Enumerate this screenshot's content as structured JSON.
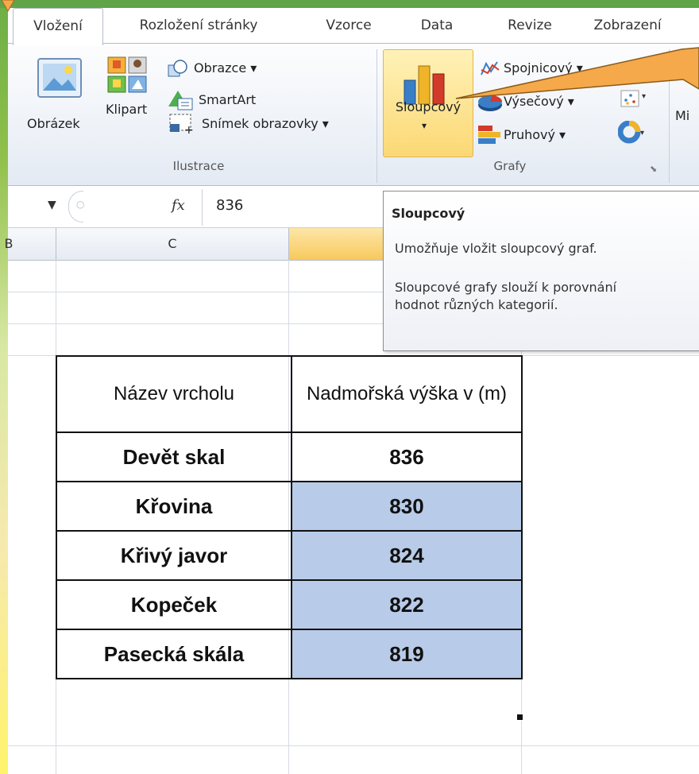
{
  "tabs": [
    {
      "label": "Vložení",
      "active": true
    },
    {
      "label": "Rozložení stránky"
    },
    {
      "label": "Vzorce"
    },
    {
      "label": "Data"
    },
    {
      "label": "Revize"
    },
    {
      "label": "Zobrazení"
    }
  ],
  "ribbon": {
    "ilustrace": {
      "obrazek": "Obrázek",
      "klipart": "Klipart",
      "obrazce": "Obrazce ▾",
      "smartart": "SmartArt",
      "snimek": "Snímek obrazovky ▾",
      "group_label": "Ilustrace"
    },
    "grafy": {
      "sloupcovy": "Sloupcový",
      "spojnicovy": "Spojnicový ▾",
      "vysecovy": "Výsečový ▾",
      "pruhovy": "Pruhový ▾",
      "group_label": "Grafy",
      "cut_text": "Mi"
    }
  },
  "formula_bar": {
    "fx": "fx",
    "value": "836"
  },
  "columns": {
    "b": "B",
    "c": "C"
  },
  "tooltip": {
    "title": "Sloupcový",
    "line1": "Umožňuje vložit sloupcový graf.",
    "line2": "Sloupcové grafy slouží k porovnání hodnot různých kategorií."
  },
  "table": {
    "header_name": "Název vrcholu",
    "header_value": "Nadmořská výška v (m)",
    "rows": [
      {
        "name": "Devět skal",
        "value": "836"
      },
      {
        "name": "Křovina",
        "value": "830"
      },
      {
        "name": "Křivý javor",
        "value": "824"
      },
      {
        "name": "Kopeček",
        "value": "822"
      },
      {
        "name": "Pasecká skála",
        "value": "819"
      }
    ]
  },
  "colors": {
    "accent": "#f5a94a",
    "selection": "#b8cbe8",
    "ribbon_active": "#fbd874"
  }
}
